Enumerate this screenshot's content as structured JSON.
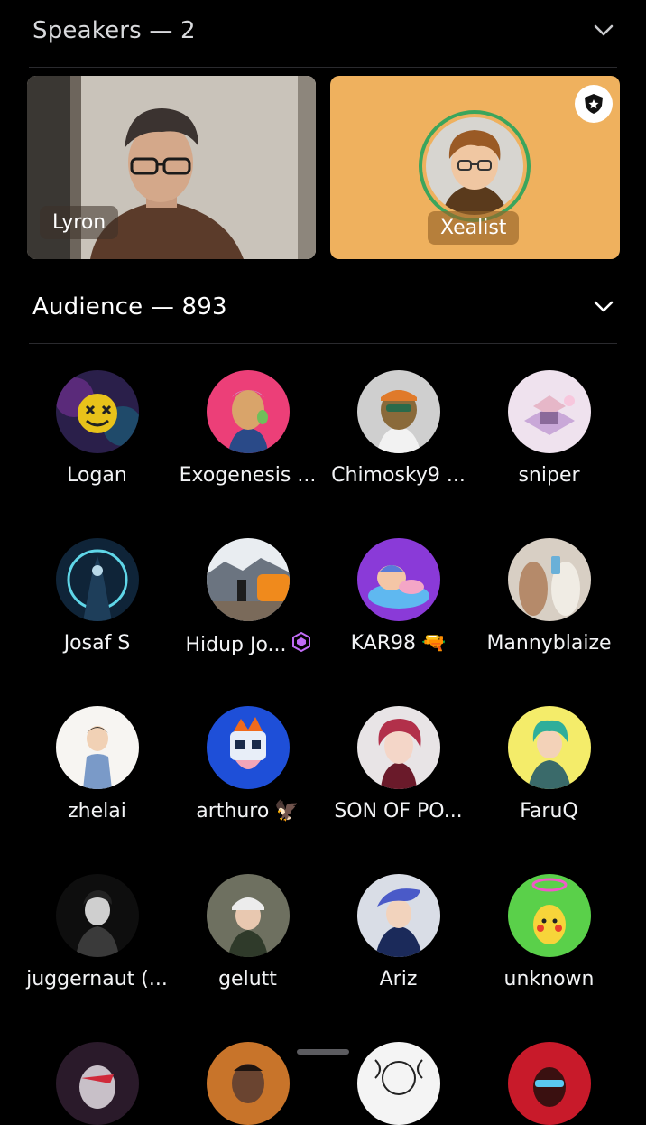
{
  "speakers": {
    "header": "Speakers — 2",
    "items": [
      {
        "name": "Lyron"
      },
      {
        "name": "Xealist"
      }
    ]
  },
  "audience": {
    "header": "Audience — 893",
    "rows": [
      [
        {
          "name": "Logan"
        },
        {
          "name": "Exogenesis ..."
        },
        {
          "name": "Chimosky9 ..."
        },
        {
          "name": "sniper"
        }
      ],
      [
        {
          "name": "Josaf S"
        },
        {
          "name": "Hidup Jo...",
          "badge": "nitro-gem-icon"
        },
        {
          "name": "KAR98",
          "emoji": "🔫"
        },
        {
          "name": "Mannyblaize"
        }
      ],
      [
        {
          "name": "zhelai"
        },
        {
          "name": "arthuro",
          "emoji": "🦅"
        },
        {
          "name": "SON OF PO..."
        },
        {
          "name": "FaruQ"
        }
      ],
      [
        {
          "name": "juggernaut (..."
        },
        {
          "name": "gelutt"
        },
        {
          "name": "Ariz"
        },
        {
          "name": "unknown"
        }
      ]
    ]
  },
  "colors": {
    "background": "#000000",
    "speaking_ring": "#3ba55c",
    "xealist_tile": "#efb15e",
    "nitro_badge": "#c06bf5"
  }
}
